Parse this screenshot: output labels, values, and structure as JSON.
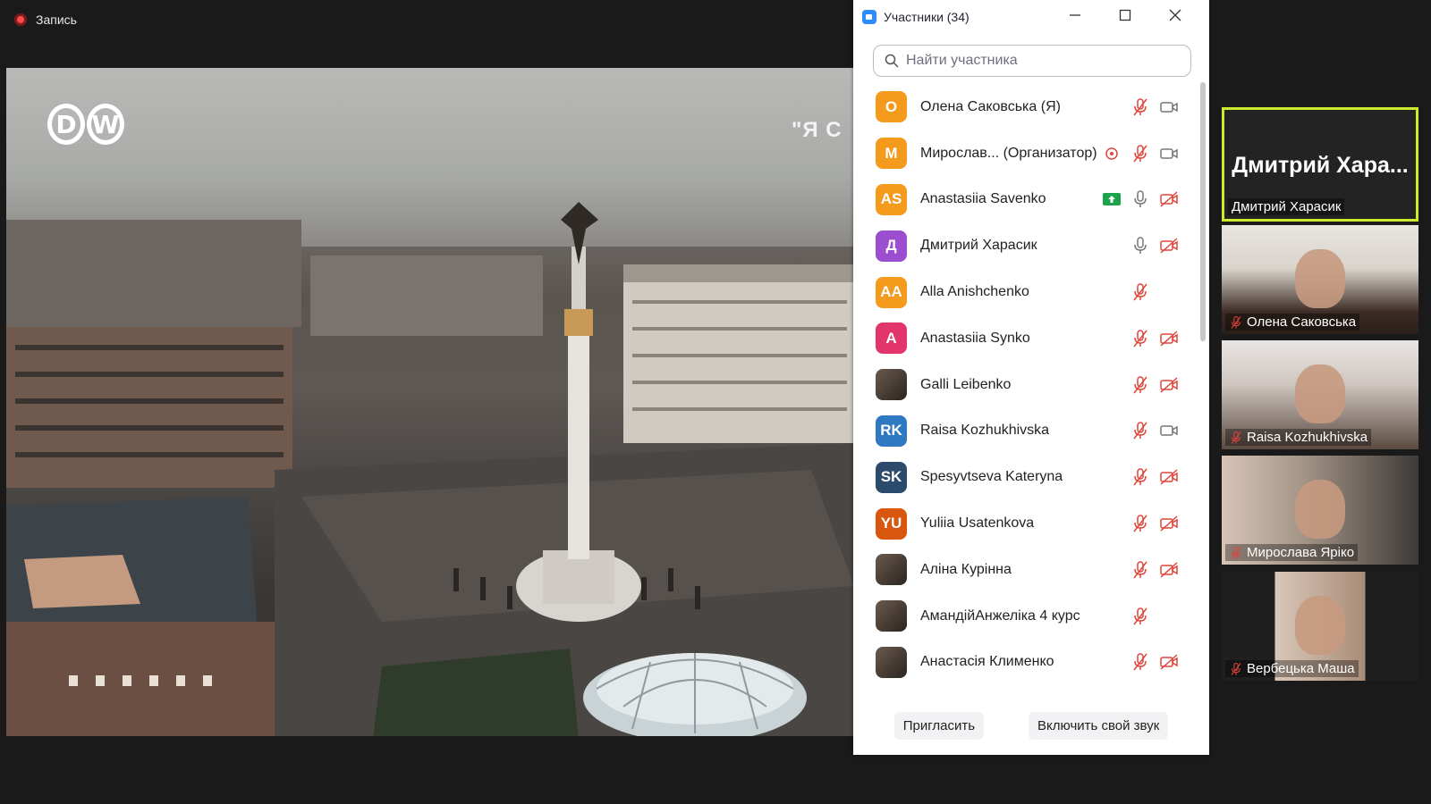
{
  "recording": {
    "label": "Запись"
  },
  "video": {
    "logo_letters": [
      "D",
      "W"
    ],
    "caption": "\"Я С"
  },
  "panel": {
    "title": "Участники (34)",
    "search_placeholder": "Найти участника",
    "invite_label": "Пригласить",
    "unmute_label": "Включить свой звук",
    "participants": [
      {
        "initials": "О",
        "color": "#f49a1c",
        "name": "Олена Саковська (Я)",
        "mic": "muted",
        "video": "on"
      },
      {
        "initials": "М",
        "color": "#f49a1c",
        "name": "Мирослав...  (Организатор)",
        "mic": "muted",
        "video": "on",
        "host_icon": true
      },
      {
        "initials": "AS",
        "color": "#f49a1c",
        "name": "Anastasiia Savenko",
        "mic": "on",
        "video": "off",
        "share_icon": true
      },
      {
        "initials": "Д",
        "color": "#9b4fd0",
        "name": "Дмитрий Харасик",
        "mic": "on",
        "video": "off"
      },
      {
        "initials": "AA",
        "color": "#f49a1c",
        "name": "Alla Anishchenko",
        "mic": "muted",
        "video": "none"
      },
      {
        "initials": "A",
        "color": "#e2356b",
        "name": "Anastasiia Synko",
        "mic": "muted",
        "video": "off"
      },
      {
        "initials": "",
        "color": "photo",
        "name": "Galli Leibenko",
        "mic": "muted",
        "video": "off"
      },
      {
        "initials": "RK",
        "color": "#2f78c2",
        "name": "Raisa Kozhukhivska",
        "mic": "muted",
        "video": "on"
      },
      {
        "initials": "SK",
        "color": "#2c4a6b",
        "name": "Spesyvtseva Kateryna",
        "mic": "muted",
        "video": "off"
      },
      {
        "initials": "YU",
        "color": "#d9560f",
        "name": "Yuliia Usatenkova",
        "mic": "muted",
        "video": "off"
      },
      {
        "initials": "",
        "color": "photo",
        "name": "Аліна Курінна",
        "mic": "muted",
        "video": "off"
      },
      {
        "initials": "",
        "color": "photo",
        "name": "АмандійАнжеліка 4 курс",
        "mic": "muted",
        "video": "none"
      },
      {
        "initials": "",
        "color": "photo",
        "name": "Анастасія Клименко",
        "mic": "muted",
        "video": "off"
      }
    ]
  },
  "gallery": [
    {
      "name": "Дмитрий Харасик",
      "big_name": "Дмитрий  Хара...",
      "active": true
    },
    {
      "name": "Олена Саковська",
      "muted": true
    },
    {
      "name": "Raisa Kozhukhivska",
      "muted": true
    },
    {
      "name": "Мирослава Яріко",
      "muted": true
    },
    {
      "name": "Вербецька Маша",
      "muted": true
    }
  ]
}
